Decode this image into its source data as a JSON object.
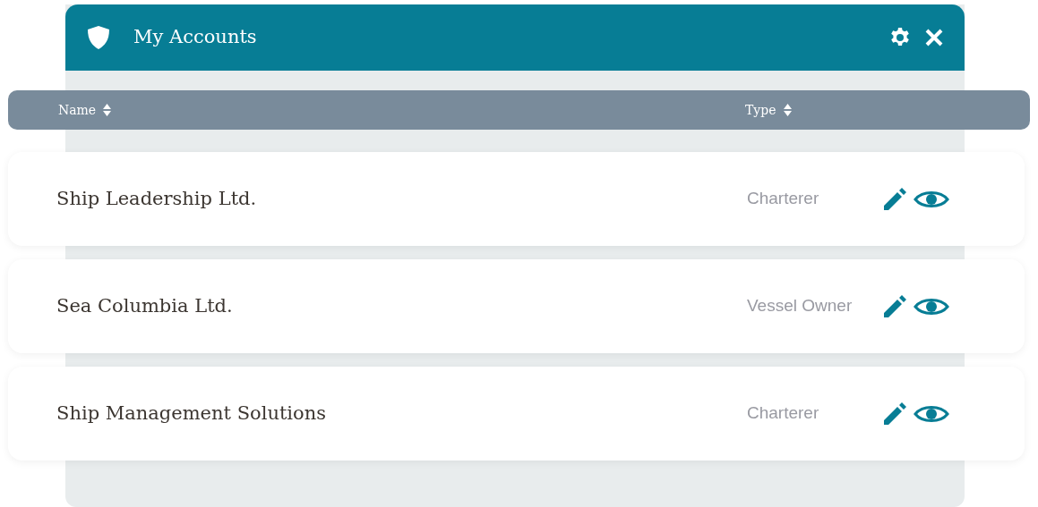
{
  "window": {
    "title": "My Accounts"
  },
  "table": {
    "columns": [
      {
        "label": "Name"
      },
      {
        "label": "Type"
      }
    ],
    "rows": [
      {
        "name": "Ship Leadership Ltd.",
        "type": "Charterer"
      },
      {
        "name": "Sea Columbia Ltd.",
        "type": "Vessel Owner"
      },
      {
        "name": "Ship Management Solutions",
        "type": "Charterer"
      }
    ]
  }
}
